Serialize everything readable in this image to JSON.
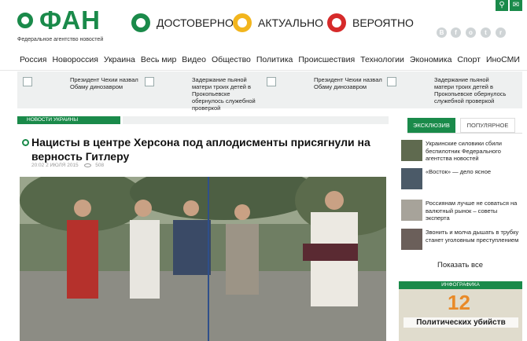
{
  "brand": {
    "name": "ФАН",
    "subtitle": "Федеральное агентство новостей"
  },
  "badges": [
    {
      "label": "ДОСТОВЕРНО",
      "color": "#1a8a4a"
    },
    {
      "label": "АКТУАЛЬНО",
      "color": "#f2b51d"
    },
    {
      "label": "ВЕРОЯТНО",
      "color": "#d62a2a"
    }
  ],
  "nav": [
    "Россия",
    "Новороссия",
    "Украина",
    "Весь мир",
    "Видео",
    "Общество",
    "Политика",
    "Происшествия",
    "Технологии",
    "Экономика",
    "Спорт",
    "ИноСМИ"
  ],
  "ticker": [
    "Президент Чехии назвал Обаму динозавром",
    "Задержание пьяной матери троих детей в Прокопьевске обернулось служебной проверкой",
    "Президент Чехии назвал Обаму динозавром",
    "Задержание пьяной матери троих детей в Прокопьевске обернулось служебной проверкой"
  ],
  "section_label": "НОВОСТИ УКРАИНЫ",
  "article": {
    "title": "Нацисты в центре Херсона под аплодисменты присягнули на верность Гитлеру",
    "date": "20:02 2 ИЮЛЯ 2015",
    "views": "508"
  },
  "sidebar": {
    "tab_active": "ЭКСКЛЮЗИВ",
    "tab_other": "ПОПУЛЯРНОЕ",
    "items": [
      "Украинские силовики сбили беспилотник Федерального агентства новостей",
      "«Восток» — дело ясное",
      "Россиянам лучше не совать­ся на валютный рынок – советы эксперта",
      "Звонить и молча дышать в трубку станет уголовным преступлением"
    ],
    "show_all": "Показать все",
    "infographic_label": "ИНФОГРАФИКА",
    "infographic_number": "12",
    "infographic_title": "Политических убийств"
  }
}
